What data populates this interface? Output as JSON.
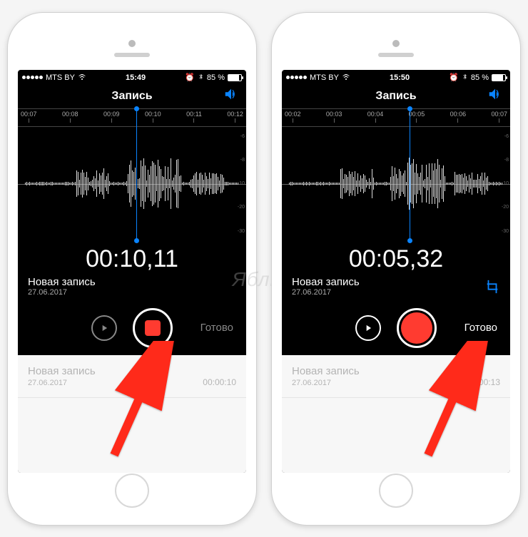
{
  "watermark": "Яблык",
  "phones": [
    {
      "status": {
        "carrier": "MTS BY",
        "wifi": true,
        "time": "15:49",
        "alarm": true,
        "bt": true,
        "battery_pct": "85 %"
      },
      "title": "Запись",
      "ruler": [
        "00:07",
        "00:08",
        "00:09",
        "00:10",
        "00:11",
        "00:12"
      ],
      "playhead_left_pct": 52,
      "db": [
        "-6",
        "-8",
        "-10",
        "-20",
        "-30"
      ],
      "timer": "00:10,11",
      "rec_name": "Новая запись",
      "rec_date": "27.06.2017",
      "rec_state": "recording_stop",
      "play_enabled": false,
      "show_crop": false,
      "done_enabled": false,
      "done_label": "Готово",
      "list": {
        "name": "Новая запись",
        "date": "27.06.2017",
        "dur": "00:00:10"
      },
      "arrow_target": "record"
    },
    {
      "status": {
        "carrier": "MTS BY",
        "wifi": true,
        "time": "15:50",
        "alarm": true,
        "bt": true,
        "battery_pct": "85 %"
      },
      "title": "Запись",
      "ruler": [
        "00:02",
        "00:03",
        "00:04",
        "00:05",
        "00:06",
        "00:07"
      ],
      "playhead_left_pct": 56,
      "db": [
        "-6",
        "-8",
        "-10",
        "-20",
        "-30"
      ],
      "timer": "00:05,32",
      "rec_name": "Новая запись",
      "rec_date": "27.06.2017",
      "rec_state": "ready_record",
      "play_enabled": true,
      "show_crop": true,
      "done_enabled": true,
      "done_label": "Готово",
      "list": {
        "name": "Новая запись",
        "date": "27.06.2017",
        "dur": "00:00:13"
      },
      "arrow_target": "done"
    }
  ]
}
